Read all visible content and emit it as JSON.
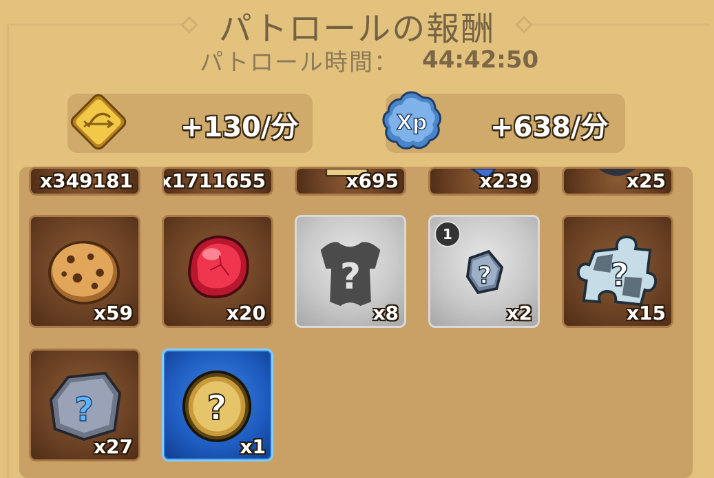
{
  "header": {
    "title": "パトロールの報酬",
    "time_label": "パトロール時間：",
    "time_value": "44:42:50"
  },
  "rates": {
    "gold": {
      "icon": "bow-coin-icon",
      "value": "+130/分"
    },
    "xp": {
      "icon": "xp-badge-icon",
      "value": "+638/分"
    }
  },
  "rewards": {
    "row0": [
      {
        "qty": "x349181"
      },
      {
        "qty": "x1711655"
      },
      {
        "qty": "x695"
      },
      {
        "qty": "x239"
      },
      {
        "qty": "x25"
      }
    ],
    "row1": [
      {
        "icon": "cookie-icon",
        "qty": "x59"
      },
      {
        "icon": "red-gem-icon",
        "qty": "x20"
      },
      {
        "icon": "mystery-armor-icon",
        "qty": "x8"
      },
      {
        "icon": "mystery-shard-icon",
        "qty": "x2",
        "badge": "1"
      },
      {
        "icon": "mystery-puzzle-icon",
        "qty": "x15"
      }
    ],
    "row2": [
      {
        "icon": "mystery-stone-icon",
        "qty": "x27"
      },
      {
        "icon": "mystery-coin-icon",
        "qty": "x1"
      }
    ]
  }
}
